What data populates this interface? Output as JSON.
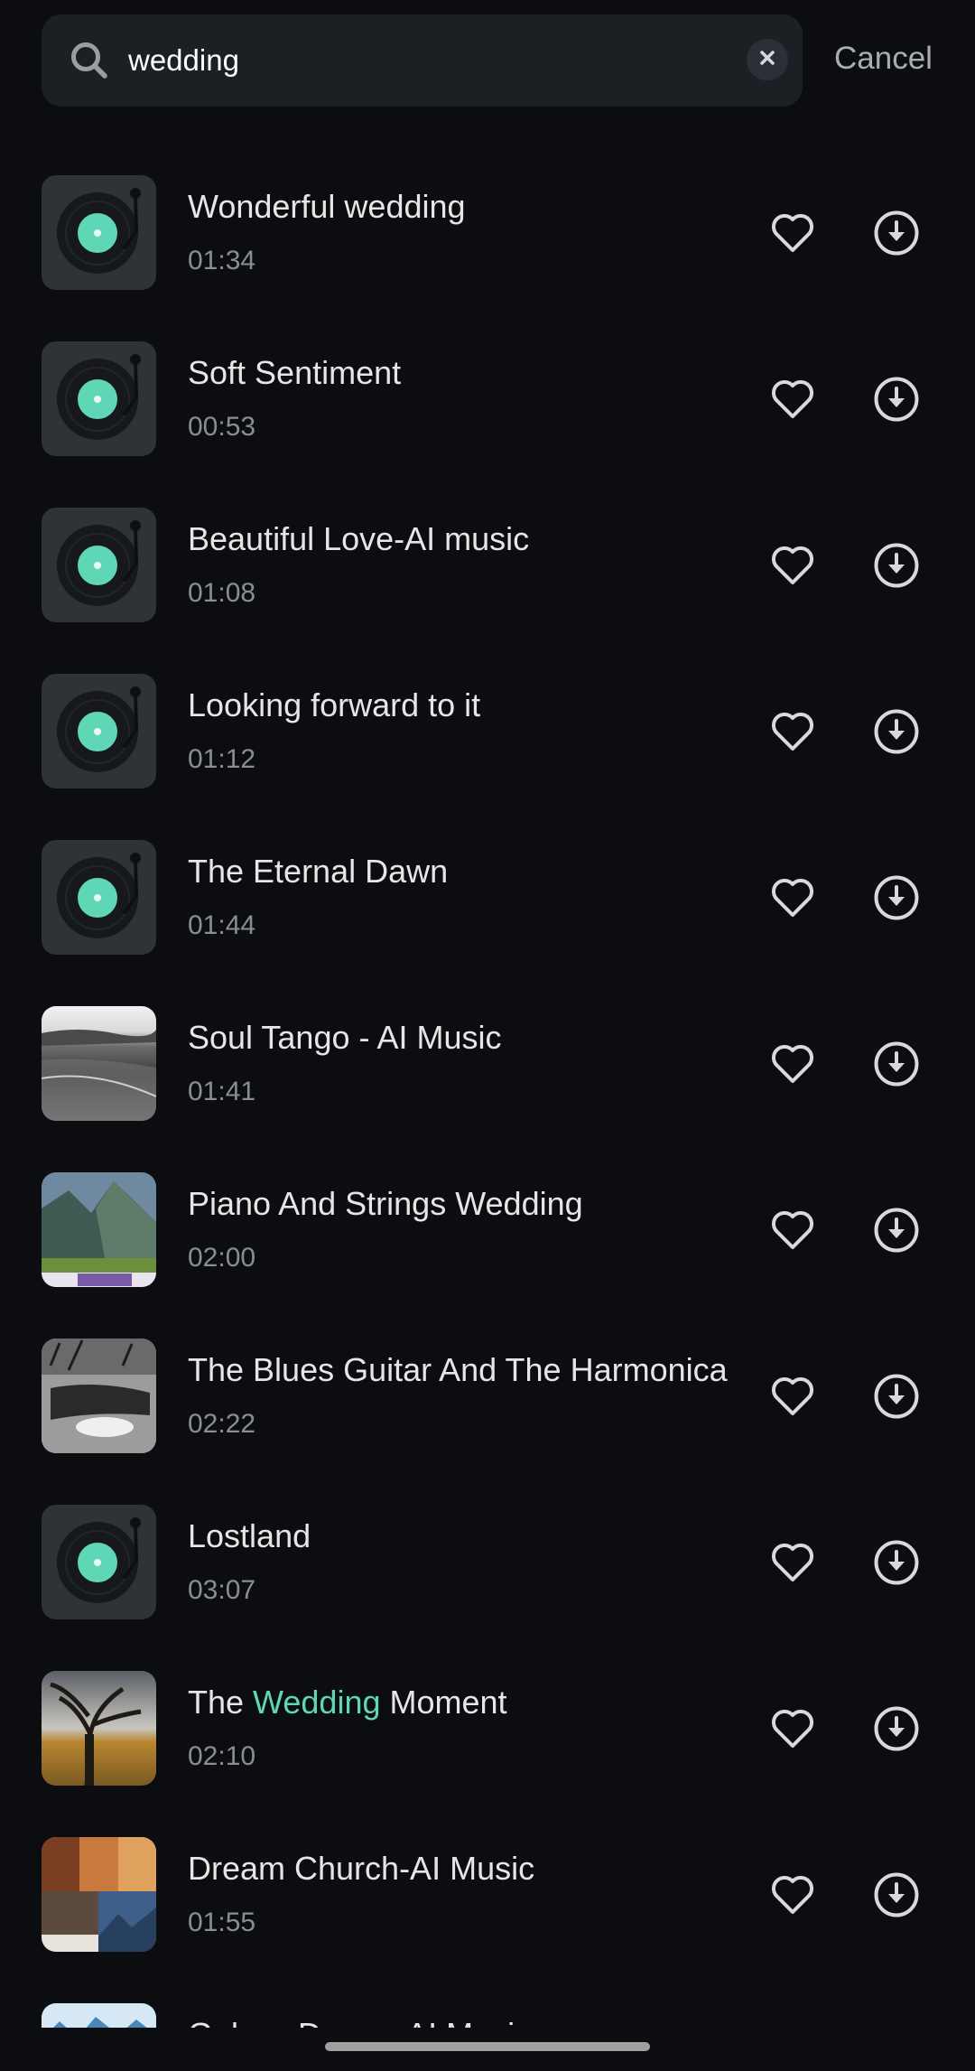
{
  "search": {
    "query": "wedding",
    "cancel_label": "Cancel",
    "icon": "search-icon",
    "clear_icon": "clear-icon"
  },
  "colors": {
    "background": "#0b0d10",
    "search_bg": "#1c1f23",
    "accent": "#5fd6b5",
    "title": "#e6e6e6",
    "duration": "#8a8d92"
  },
  "tracks": [
    {
      "title_parts": [
        {
          "text": "Wonderful wedding"
        }
      ],
      "duration": "01:34",
      "cover": "vinyl"
    },
    {
      "title_parts": [
        {
          "text": "Soft Sentiment"
        }
      ],
      "duration": "00:53",
      "cover": "vinyl"
    },
    {
      "title_parts": [
        {
          "text": "Beautiful Love-AI music"
        }
      ],
      "duration": "01:08",
      "cover": "vinyl"
    },
    {
      "title_parts": [
        {
          "text": "Looking forward to it"
        }
      ],
      "duration": "01:12",
      "cover": "vinyl"
    },
    {
      "title_parts": [
        {
          "text": "The Eternal Dawn"
        }
      ],
      "duration": "01:44",
      "cover": "vinyl"
    },
    {
      "title_parts": [
        {
          "text": "Soul Tango - AI Music"
        }
      ],
      "duration": "01:41",
      "cover": "lake-photo"
    },
    {
      "title_parts": [
        {
          "text": "Piano And Strings Wedding"
        }
      ],
      "duration": "02:00",
      "cover": "mountain-photo"
    },
    {
      "title_parts": [
        {
          "text": "The Blues Guitar And The Harmonica"
        }
      ],
      "duration": "02:22",
      "cover": "bw-guitar-photo"
    },
    {
      "title_parts": [
        {
          "text": "Lostland"
        }
      ],
      "duration": "03:07",
      "cover": "vinyl"
    },
    {
      "title_parts": [
        {
          "text": "The "
        },
        {
          "text": "Wedding",
          "highlight": true
        },
        {
          "text": " Moment"
        }
      ],
      "duration": "02:10",
      "cover": "tree-photo"
    },
    {
      "title_parts": [
        {
          "text": "Dream Church-AI Music"
        }
      ],
      "duration": "01:55",
      "cover": "collage-photo"
    },
    {
      "title_parts": [
        {
          "text": "Galaxy Dream-AI Music"
        }
      ],
      "duration": "",
      "cover": "blue-photo"
    }
  ],
  "row_icons": {
    "favorite": "heart-icon",
    "download": "download-icon"
  }
}
